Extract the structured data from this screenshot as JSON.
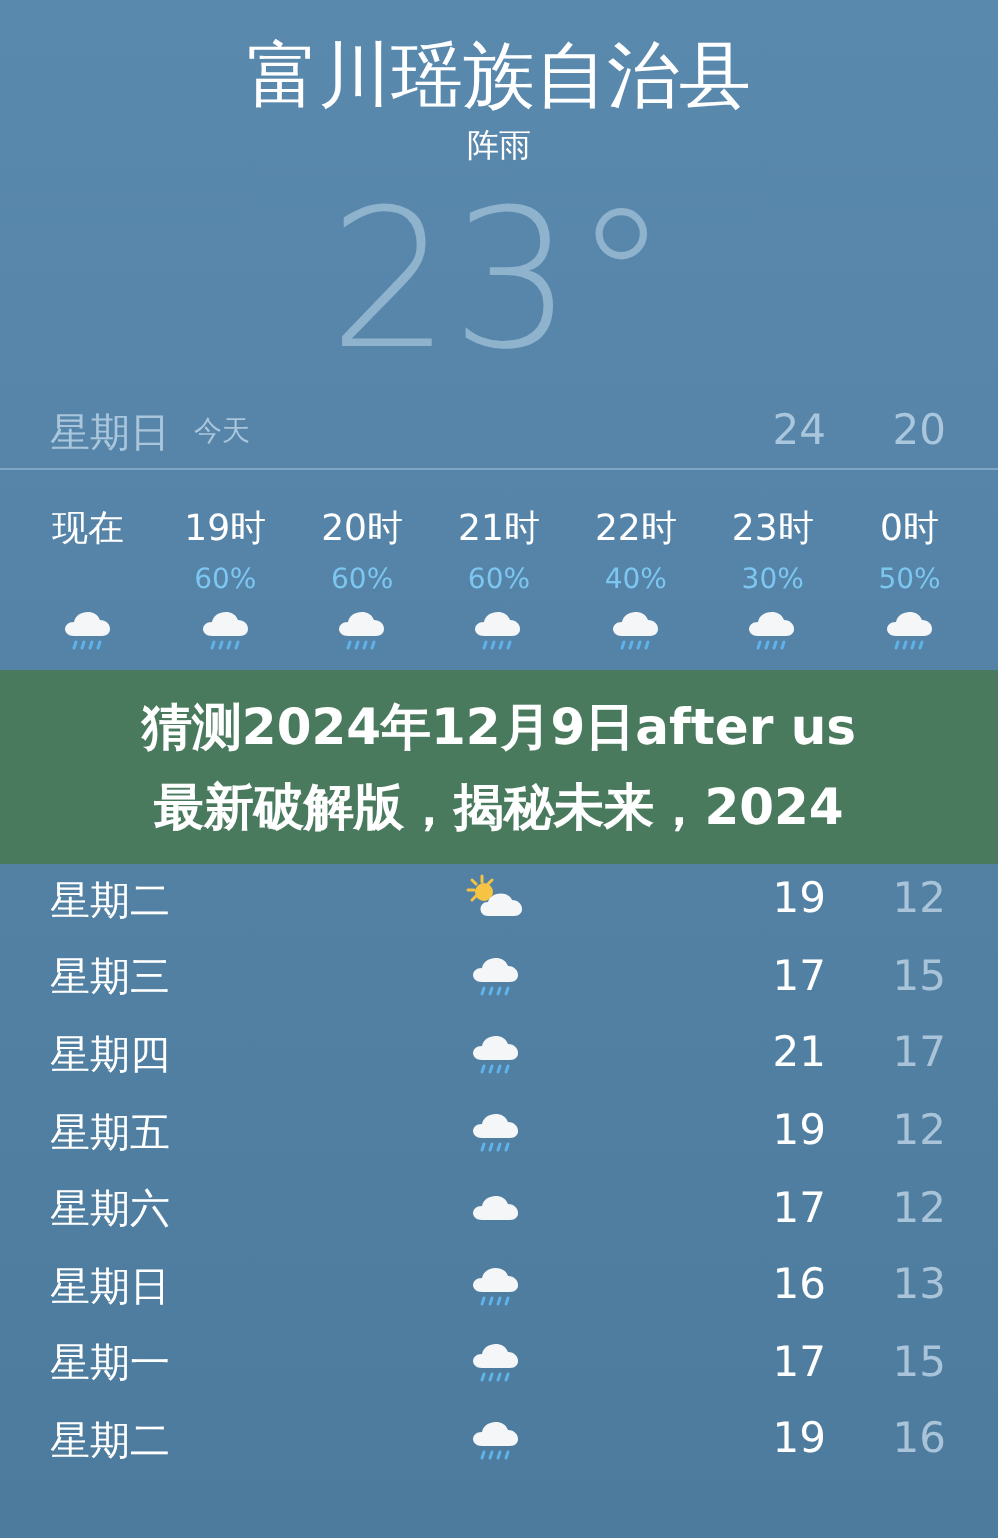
{
  "location": {
    "city": "富川瑶族自治县",
    "condition": "阵雨",
    "temperature": "23°"
  },
  "today": {
    "day": "星期日",
    "label": "今天",
    "high": "24",
    "low": "20"
  },
  "hourly": [
    {
      "time": "现在",
      "kind": "rain"
    },
    {
      "time": "19时",
      "chance": "60%",
      "kind": "rain"
    },
    {
      "time": "20时",
      "chance": "60%",
      "kind": "rain"
    },
    {
      "time": "21时",
      "chance": "60%",
      "kind": "rain"
    },
    {
      "time": "22时",
      "chance": "40%",
      "kind": "rain"
    },
    {
      "time": "23时",
      "chance": "30%",
      "kind": "rain"
    },
    {
      "time": "0时",
      "chance": "50%",
      "kind": "rain"
    }
  ],
  "daily": [
    {
      "day": "星期二",
      "kind": "partly_sunny",
      "high": "19",
      "low": "12"
    },
    {
      "day": "星期三",
      "kind": "rain",
      "high": "17",
      "low": "15"
    },
    {
      "day": "星期四",
      "kind": "rain",
      "high": "21",
      "low": "17"
    },
    {
      "day": "星期五",
      "kind": "rain",
      "high": "19",
      "low": "12"
    },
    {
      "day": "星期六",
      "kind": "cloud",
      "high": "17",
      "low": "12"
    },
    {
      "day": "星期日",
      "kind": "rain",
      "high": "16",
      "low": "13"
    },
    {
      "day": "星期一",
      "kind": "rain",
      "high": "17",
      "low": "15"
    },
    {
      "day": "星期二",
      "kind": "rain",
      "high": "19",
      "low": "16"
    }
  ],
  "banner": {
    "lines": [
      "猜测2024年12月9日after us",
      "最新破解版，揭秘未来，2024"
    ]
  }
}
